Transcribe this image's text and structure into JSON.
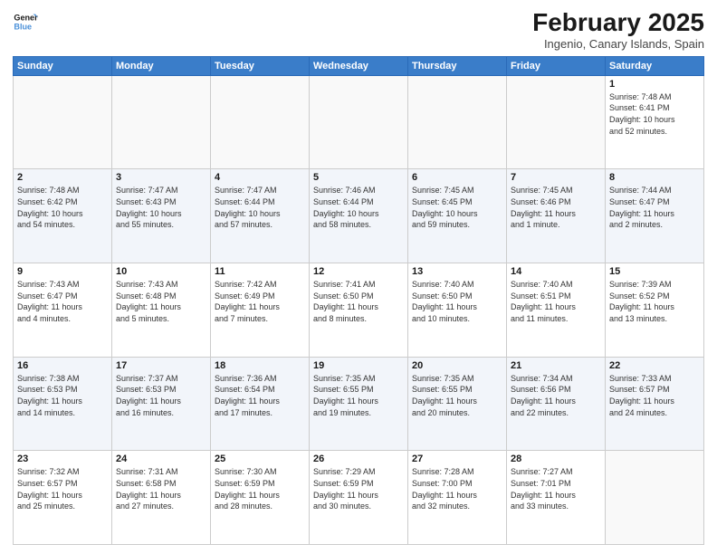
{
  "logo": {
    "line1": "General",
    "line2": "Blue"
  },
  "title": "February 2025",
  "location": "Ingenio, Canary Islands, Spain",
  "days_header": [
    "Sunday",
    "Monday",
    "Tuesday",
    "Wednesday",
    "Thursday",
    "Friday",
    "Saturday"
  ],
  "weeks": [
    {
      "alt": false,
      "days": [
        {
          "num": "",
          "info": ""
        },
        {
          "num": "",
          "info": ""
        },
        {
          "num": "",
          "info": ""
        },
        {
          "num": "",
          "info": ""
        },
        {
          "num": "",
          "info": ""
        },
        {
          "num": "",
          "info": ""
        },
        {
          "num": "1",
          "info": "Sunrise: 7:48 AM\nSunset: 6:41 PM\nDaylight: 10 hours\nand 52 minutes."
        }
      ]
    },
    {
      "alt": true,
      "days": [
        {
          "num": "2",
          "info": "Sunrise: 7:48 AM\nSunset: 6:42 PM\nDaylight: 10 hours\nand 54 minutes."
        },
        {
          "num": "3",
          "info": "Sunrise: 7:47 AM\nSunset: 6:43 PM\nDaylight: 10 hours\nand 55 minutes."
        },
        {
          "num": "4",
          "info": "Sunrise: 7:47 AM\nSunset: 6:44 PM\nDaylight: 10 hours\nand 57 minutes."
        },
        {
          "num": "5",
          "info": "Sunrise: 7:46 AM\nSunset: 6:44 PM\nDaylight: 10 hours\nand 58 minutes."
        },
        {
          "num": "6",
          "info": "Sunrise: 7:45 AM\nSunset: 6:45 PM\nDaylight: 10 hours\nand 59 minutes."
        },
        {
          "num": "7",
          "info": "Sunrise: 7:45 AM\nSunset: 6:46 PM\nDaylight: 11 hours\nand 1 minute."
        },
        {
          "num": "8",
          "info": "Sunrise: 7:44 AM\nSunset: 6:47 PM\nDaylight: 11 hours\nand 2 minutes."
        }
      ]
    },
    {
      "alt": false,
      "days": [
        {
          "num": "9",
          "info": "Sunrise: 7:43 AM\nSunset: 6:47 PM\nDaylight: 11 hours\nand 4 minutes."
        },
        {
          "num": "10",
          "info": "Sunrise: 7:43 AM\nSunset: 6:48 PM\nDaylight: 11 hours\nand 5 minutes."
        },
        {
          "num": "11",
          "info": "Sunrise: 7:42 AM\nSunset: 6:49 PM\nDaylight: 11 hours\nand 7 minutes."
        },
        {
          "num": "12",
          "info": "Sunrise: 7:41 AM\nSunset: 6:50 PM\nDaylight: 11 hours\nand 8 minutes."
        },
        {
          "num": "13",
          "info": "Sunrise: 7:40 AM\nSunset: 6:50 PM\nDaylight: 11 hours\nand 10 minutes."
        },
        {
          "num": "14",
          "info": "Sunrise: 7:40 AM\nSunset: 6:51 PM\nDaylight: 11 hours\nand 11 minutes."
        },
        {
          "num": "15",
          "info": "Sunrise: 7:39 AM\nSunset: 6:52 PM\nDaylight: 11 hours\nand 13 minutes."
        }
      ]
    },
    {
      "alt": true,
      "days": [
        {
          "num": "16",
          "info": "Sunrise: 7:38 AM\nSunset: 6:53 PM\nDaylight: 11 hours\nand 14 minutes."
        },
        {
          "num": "17",
          "info": "Sunrise: 7:37 AM\nSunset: 6:53 PM\nDaylight: 11 hours\nand 16 minutes."
        },
        {
          "num": "18",
          "info": "Sunrise: 7:36 AM\nSunset: 6:54 PM\nDaylight: 11 hours\nand 17 minutes."
        },
        {
          "num": "19",
          "info": "Sunrise: 7:35 AM\nSunset: 6:55 PM\nDaylight: 11 hours\nand 19 minutes."
        },
        {
          "num": "20",
          "info": "Sunrise: 7:35 AM\nSunset: 6:55 PM\nDaylight: 11 hours\nand 20 minutes."
        },
        {
          "num": "21",
          "info": "Sunrise: 7:34 AM\nSunset: 6:56 PM\nDaylight: 11 hours\nand 22 minutes."
        },
        {
          "num": "22",
          "info": "Sunrise: 7:33 AM\nSunset: 6:57 PM\nDaylight: 11 hours\nand 24 minutes."
        }
      ]
    },
    {
      "alt": false,
      "days": [
        {
          "num": "23",
          "info": "Sunrise: 7:32 AM\nSunset: 6:57 PM\nDaylight: 11 hours\nand 25 minutes."
        },
        {
          "num": "24",
          "info": "Sunrise: 7:31 AM\nSunset: 6:58 PM\nDaylight: 11 hours\nand 27 minutes."
        },
        {
          "num": "25",
          "info": "Sunrise: 7:30 AM\nSunset: 6:59 PM\nDaylight: 11 hours\nand 28 minutes."
        },
        {
          "num": "26",
          "info": "Sunrise: 7:29 AM\nSunset: 6:59 PM\nDaylight: 11 hours\nand 30 minutes."
        },
        {
          "num": "27",
          "info": "Sunrise: 7:28 AM\nSunset: 7:00 PM\nDaylight: 11 hours\nand 32 minutes."
        },
        {
          "num": "28",
          "info": "Sunrise: 7:27 AM\nSunset: 7:01 PM\nDaylight: 11 hours\nand 33 minutes."
        },
        {
          "num": "",
          "info": ""
        }
      ]
    }
  ]
}
